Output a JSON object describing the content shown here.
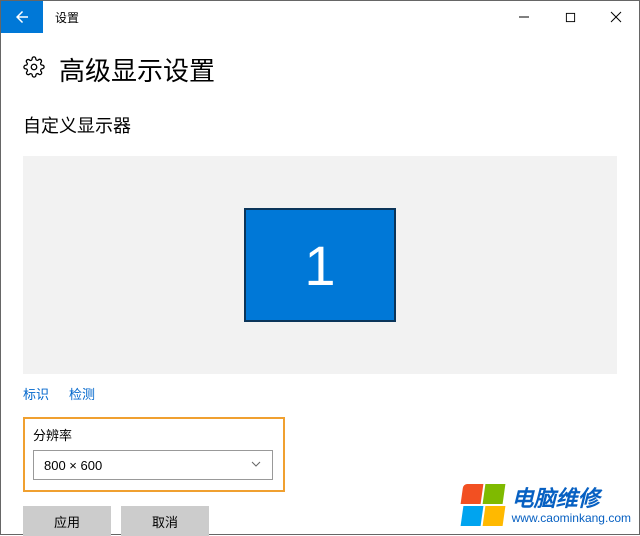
{
  "window": {
    "title": "设置"
  },
  "page": {
    "title": "高级显示设置",
    "section": "自定义显示器"
  },
  "monitor": {
    "number": "1"
  },
  "links": {
    "identify": "标识",
    "detect": "检测"
  },
  "resolution": {
    "label": "分辨率",
    "value": "800 × 600"
  },
  "buttons": {
    "apply": "应用",
    "cancel": "取消"
  },
  "watermark": {
    "line1": "电脑维修",
    "line2": "www.caominkang.com"
  }
}
